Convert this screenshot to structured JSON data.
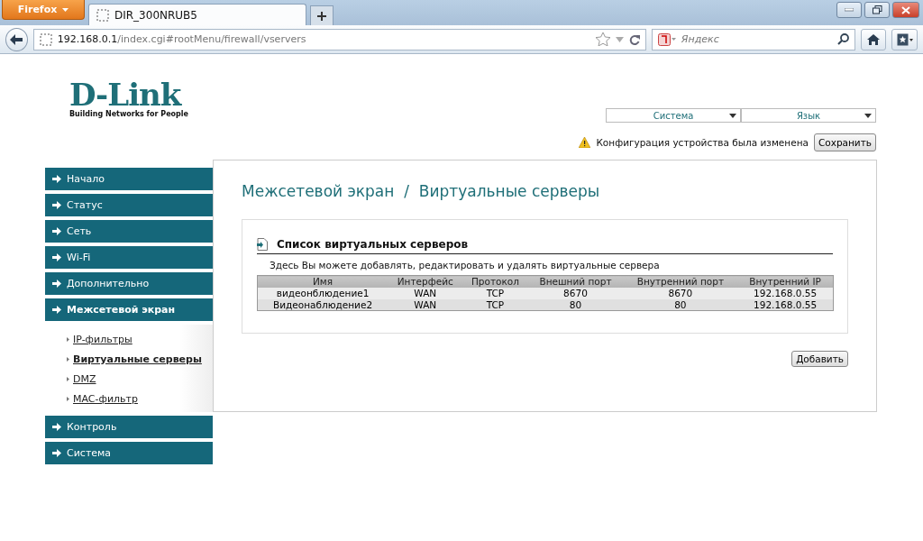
{
  "browser": {
    "menu_button": "Firefox",
    "tabs": [
      {
        "title": "DIR_300NRUB5",
        "selected": true
      }
    ],
    "url_host": "192.168.0.1",
    "url_path": "/index.cgi#rootMenu/firewall/vservers",
    "search_placeholder": "Яндекс"
  },
  "logo": {
    "text": "D-Link",
    "tagline": "Building Networks for People"
  },
  "top_selects": [
    {
      "label": "Система"
    },
    {
      "label": "Язык"
    }
  ],
  "notice": {
    "text": "Конфигурация устройства была изменена",
    "button": "Сохранить"
  },
  "sidebar": {
    "items": [
      {
        "label": "Начало",
        "expanded": false
      },
      {
        "label": "Статус",
        "expanded": false
      },
      {
        "label": "Сеть",
        "expanded": false
      },
      {
        "label": "Wi-Fi",
        "expanded": false
      },
      {
        "label": "Дополнительно",
        "expanded": false
      },
      {
        "label": "Межсетевой экран",
        "expanded": true,
        "children": [
          {
            "label": "IP-фильтры",
            "selected": false
          },
          {
            "label": "Виртуальные серверы",
            "selected": true
          },
          {
            "label": "DMZ",
            "selected": false
          },
          {
            "label": "MAC-фильтр",
            "selected": false
          }
        ]
      },
      {
        "label": "Контроль",
        "expanded": false
      },
      {
        "label": "Система",
        "expanded": false
      }
    ]
  },
  "page_title": "Межсетевой экран  /  Виртуальные серверы",
  "section": {
    "title": "Список виртуальных серверов",
    "description": "Здесь Вы можете добавлять, редактировать и удалять виртуальные сервера",
    "table": {
      "columns": [
        "Имя",
        "Интерфейс",
        "Протокол",
        "Внешний порт",
        "Внутренний порт",
        "Внутренний IP"
      ],
      "rows": [
        [
          "видеонблюдение1",
          "WAN",
          "TCP",
          "8670",
          "8670",
          "192.168.0.55"
        ],
        [
          "Видеонаблюдение2",
          "WAN",
          "TCP",
          "80",
          "80",
          "192.168.0.55"
        ]
      ]
    }
  },
  "add_button": "Добавить"
}
